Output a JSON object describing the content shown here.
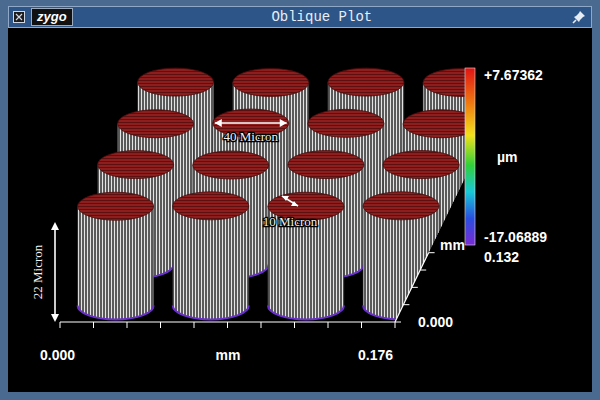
{
  "window": {
    "title": "Oblique Plot",
    "logo": "zygo"
  },
  "color_scale": {
    "max": "+7.67362",
    "unit": "µm",
    "min": "-17.06889"
  },
  "depth_axis": {
    "label": "mm",
    "max": "0.132",
    "min": "0.000"
  },
  "x_axis": {
    "label": "mm",
    "min": "0.000",
    "max": "0.176"
  },
  "annotations": [
    {
      "text": "40 Micron",
      "kind": "horizontal"
    },
    {
      "text": "10 Micron",
      "kind": "diagonal"
    },
    {
      "text": "22 Micron",
      "kind": "vertical"
    }
  ],
  "surface": {
    "floor_um": -17.06889,
    "pillar_tops_um": [
      [
        7.6,
        7.5,
        7.6,
        7.5
      ],
      [
        7.5,
        7.67,
        7.6,
        7.5
      ],
      [
        7.6,
        7.5,
        7.6,
        7.6
      ],
      [
        7.5,
        7.6,
        7.5,
        7.6
      ]
    ]
  }
}
